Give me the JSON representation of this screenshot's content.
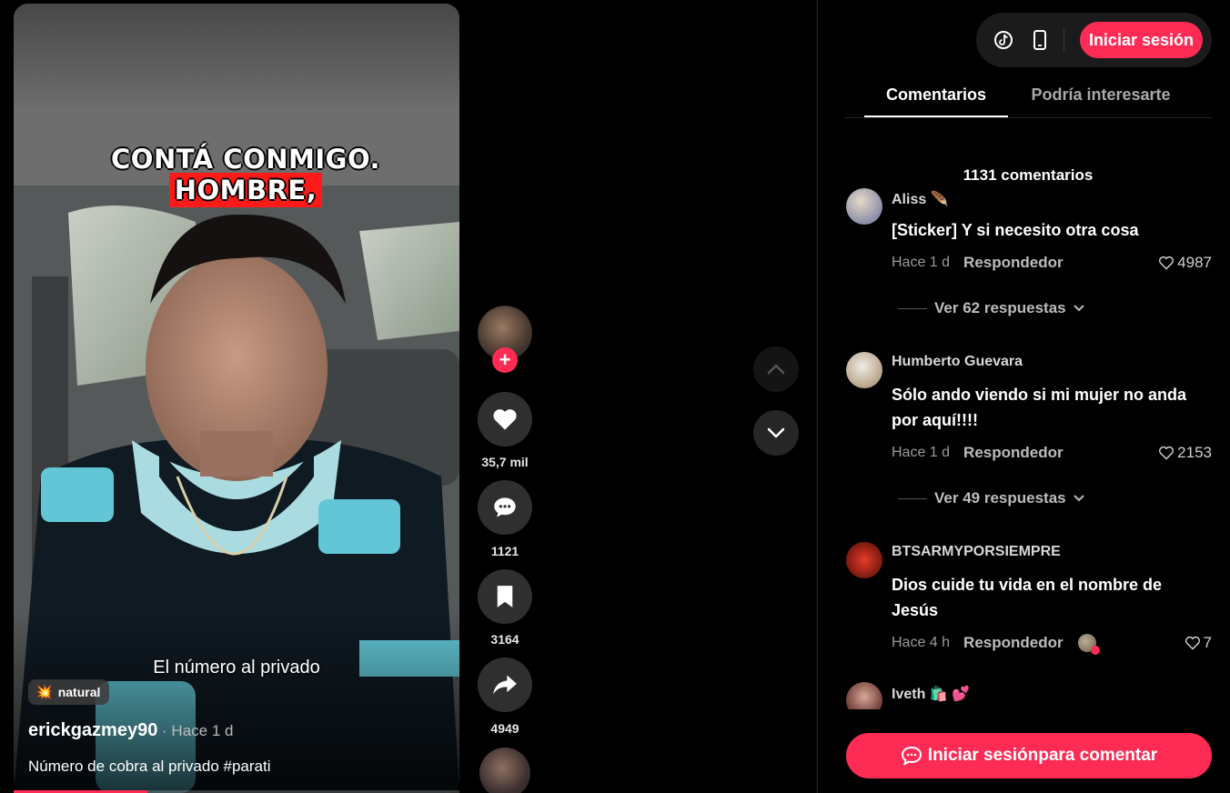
{
  "video": {
    "caption_part1": "CONTÁ CONMIGO.",
    "caption_highlight": "HOMBRE,",
    "subtitle": "El número al privado",
    "tag_icon": "💥",
    "tag_label": "natural",
    "author": "erickgazmey90",
    "time": " · Hace 1 d",
    "description": "Número de cobra al privado #parati",
    "progress_fraction": 0.3
  },
  "actions": {
    "likes": "35,7 mil",
    "comments": "1121",
    "saves": "3164",
    "shares": "4949"
  },
  "header": {
    "login_label": "Iniciar sesión"
  },
  "tabs": {
    "comments": "Comentarios",
    "interest": "Podría interesarte"
  },
  "comments_section": {
    "count_label": "1131 comentarios",
    "reply_label": "Respondedor",
    "items": [
      {
        "user": "Aliss 🪶",
        "text": "[Sticker] Y si necesito otra cosa",
        "time": "Hace 1 d",
        "likes": "4987",
        "replies": "Ver 62 respuestas"
      },
      {
        "user": "Humberto Guevara",
        "text": "Sólo ando viendo si mi mujer no anda por aquí!!!!",
        "time": "Hace 1 d",
        "likes": "2153",
        "replies": "Ver 49 respuestas"
      },
      {
        "user": "BTSARMYPORSIEMPRE",
        "text": "Dios cuide tu vida en el nombre de Jesús",
        "time": "Hace 4 h",
        "likes": "7"
      },
      {
        "user": "Iveth 🛍️ 💕"
      }
    ]
  },
  "footer": {
    "comment_button": "Iniciar sesiónpara comentar"
  },
  "colors": {
    "accent": "#fe2c55",
    "background": "#000000"
  }
}
